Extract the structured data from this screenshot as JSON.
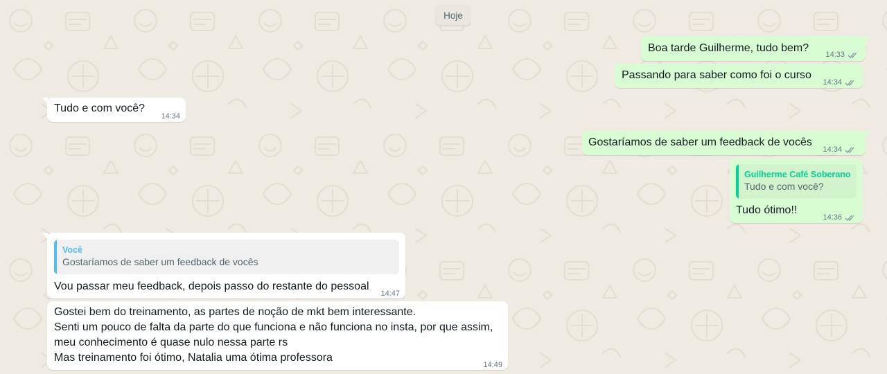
{
  "date_chip": "Hoje",
  "colors": {
    "outgoing_bubble": "#d9fdd3",
    "incoming_bubble": "#ffffff",
    "background": "#efeae2",
    "timestamp": "#667781",
    "read_ticks": "#8696a0",
    "quote_green": "#06cf9c",
    "quote_blue": "#53bdeb"
  },
  "messages": [
    {
      "direction": "outgoing",
      "text": "Boa tarde Guilherme, tudo bem?",
      "time": "14:33",
      "status": "delivered"
    },
    {
      "direction": "outgoing",
      "text": "Passando para saber como foi o curso",
      "time": "14:34",
      "status": "delivered"
    },
    {
      "direction": "incoming",
      "text": "Tudo e com você?",
      "time": "14:34"
    },
    {
      "direction": "outgoing",
      "text": "Gostaríamos de saber um feedback de vocês",
      "time": "14:34",
      "status": "delivered"
    },
    {
      "direction": "outgoing",
      "quote": {
        "author": "Guilherme Café Soberano",
        "text": "Tudo e com você?"
      },
      "text": "Tudo ótimo!!",
      "time": "14:36",
      "status": "delivered"
    },
    {
      "direction": "incoming",
      "quote": {
        "author": "Você",
        "text": "Gostaríamos de saber um feedback de vocês"
      },
      "text": "Vou passar meu feedback, depois passo do restante do pessoal",
      "time": "14:47"
    },
    {
      "direction": "incoming",
      "lines": [
        "Gostei bem do treinamento, as partes de noção de mkt bem interessante.",
        "Senti um pouco de falta da parte do que funciona e não funciona no insta, por que assim,",
        "meu conhecimento é quase nulo nessa parte rs",
        "Mas treinamento foi ótimo, Natalia uma ótima professora"
      ],
      "time": "14:49"
    }
  ]
}
